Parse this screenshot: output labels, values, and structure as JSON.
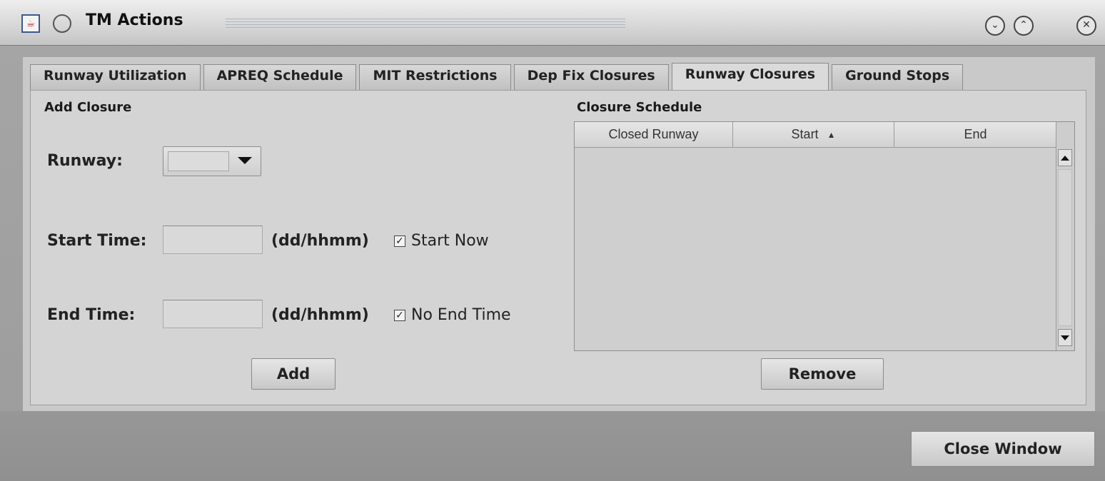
{
  "window": {
    "title": "TM Actions",
    "icon": "java-coffee-icon"
  },
  "tabs": [
    {
      "label": "Runway Utilization"
    },
    {
      "label": "APREQ Schedule"
    },
    {
      "label": "MIT Restrictions"
    },
    {
      "label": "Dep Fix Closures"
    },
    {
      "label": "Runway Closures",
      "active": true
    },
    {
      "label": "Ground Stops"
    }
  ],
  "add_closure": {
    "section_title": "Add Closure",
    "runway_label": "Runway:",
    "runway_value": "",
    "start_label": "Start Time:",
    "start_value": "",
    "start_unit": "(dd/hhmm)",
    "start_now_label": "Start Now",
    "start_now_checked": true,
    "end_label": "End Time:",
    "end_value": "",
    "end_unit": "(dd/hhmm)",
    "no_end_label": "No End Time",
    "no_end_checked": true,
    "add_button": "Add"
  },
  "closure_schedule": {
    "section_title": "Closure Schedule",
    "columns": [
      "Closed Runway",
      "Start",
      "End"
    ],
    "sorted_column": "Start",
    "sort_direction": "ascending",
    "rows": [],
    "remove_button": "Remove"
  },
  "footer": {
    "close_button": "Close Window"
  }
}
